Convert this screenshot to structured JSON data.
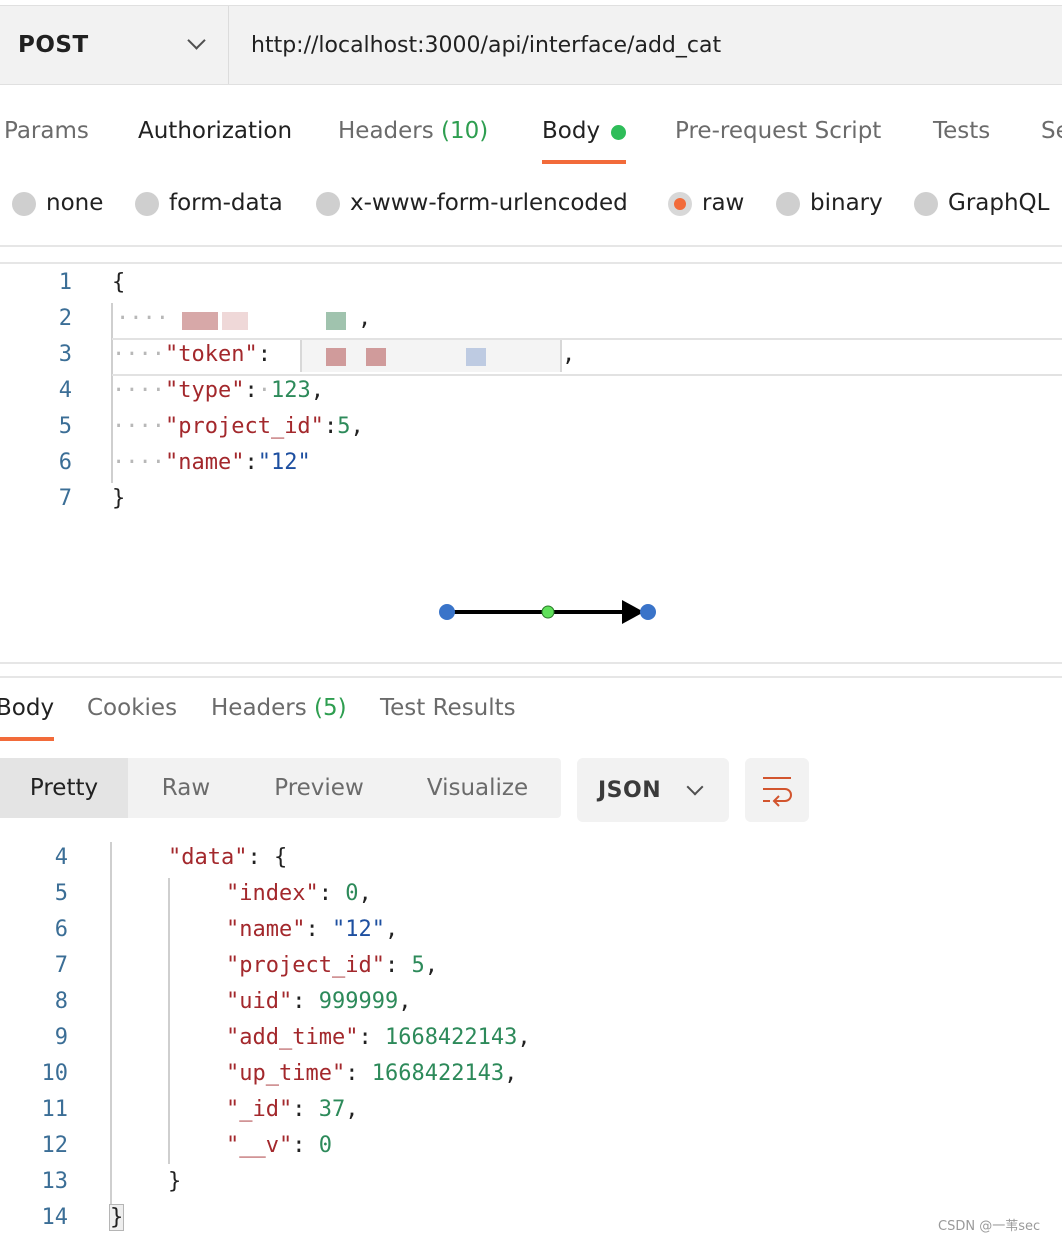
{
  "request": {
    "method": "POST",
    "url": "http://localhost:3000/api/interface/add_cat"
  },
  "request_tabs": {
    "params": "Params",
    "authorization": "Authorization",
    "headers": "Headers",
    "headers_count": "(10)",
    "body": "Body",
    "prerequest": "Pre-request Script",
    "tests": "Tests",
    "settings_partial": "Se"
  },
  "body_types": {
    "none": "none",
    "form_data": "form-data",
    "urlencoded": "x-www-form-urlencoded",
    "raw": "raw",
    "binary": "binary",
    "graphql": "GraphQL",
    "selected": "raw"
  },
  "request_body": {
    "line_numbers": [
      "1",
      "2",
      "3",
      "4",
      "5",
      "6",
      "7"
    ],
    "open_brace": "{",
    "close_brace": "}",
    "line3_key": "\"token\"",
    "line4_key": "\"type\"",
    "line4_value": "123",
    "line5_key": "\"project_id\"",
    "line5_value": "5",
    "line6_key": "\"name\"",
    "line6_value": "\"12\""
  },
  "response_tabs": {
    "body": "Body",
    "cookies": "Cookies",
    "headers": "Headers",
    "headers_count": "(5)",
    "test_results": "Test Results"
  },
  "view_modes": {
    "pretty": "Pretty",
    "raw": "Raw",
    "preview": "Preview",
    "visualize": "Visualize",
    "active": "Pretty"
  },
  "format": "JSON",
  "response_body": {
    "line_numbers": [
      "4",
      "5",
      "6",
      "7",
      "8",
      "9",
      "10",
      "11",
      "12",
      "13",
      "14"
    ],
    "data_key": "\"data\"",
    "open_brace": "{",
    "index_key": "\"index\"",
    "index_value": "0",
    "name_key": "\"name\"",
    "name_value": "\"12\"",
    "project_id_key": "\"project_id\"",
    "project_id_value": "5",
    "uid_key": "\"uid\"",
    "uid_value": "999999",
    "add_time_key": "\"add_time\"",
    "add_time_value": "1668422143",
    "up_time_key": "\"up_time\"",
    "up_time_value": "1668422143",
    "id_key": "\"_id\"",
    "id_value": "37",
    "v_key": "\"__v\"",
    "v_value": "0",
    "inner_close": "}",
    "outer_close": "}"
  },
  "watermark": "CSDN @一苇sec",
  "colors": {
    "accent": "#f26b3a",
    "status_green": "#2ebd59",
    "json_key": "#a3282c",
    "json_number": "#2d8a5a",
    "json_string": "#1d4fa0",
    "line_number": "#3b6e96"
  }
}
